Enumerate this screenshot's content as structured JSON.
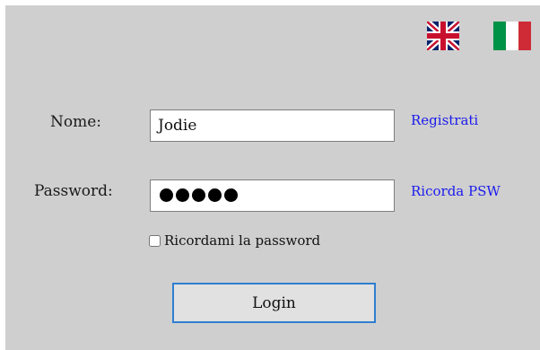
{
  "languages": [
    {
      "icon": "uk-flag-icon",
      "code": "en"
    },
    {
      "icon": "italy-flag-icon",
      "code": "it"
    }
  ],
  "form": {
    "name_label": "Nome:",
    "name_value": "Jodie",
    "password_label": "Password:",
    "password_value": "•••••",
    "password_length": 5,
    "register_link": "Registrati",
    "recover_link": "Ricorda PSW",
    "remember_label": "Ricordami la password",
    "remember_checked": false,
    "login_button": "Login"
  },
  "colors": {
    "panel_background": "#cfcfcf",
    "link": "#1a1aee",
    "button_border_focus": "#2f7fd1",
    "italy_green": "#009246",
    "italy_red": "#ce2b37",
    "uk_blue": "#012169",
    "uk_red": "#c8102e"
  }
}
